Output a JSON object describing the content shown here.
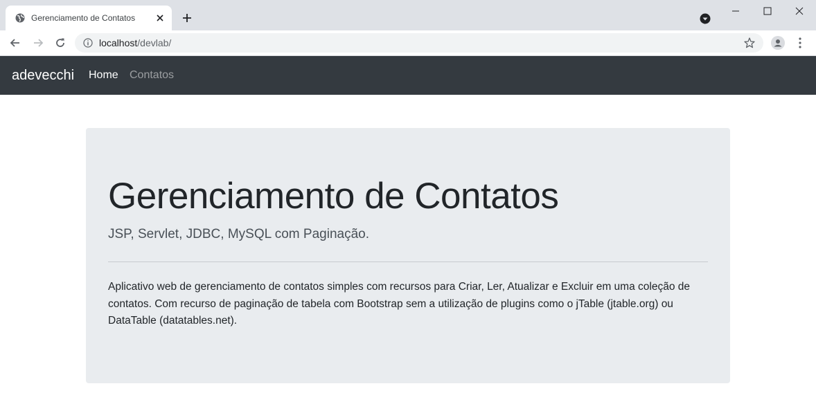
{
  "browser": {
    "tab_title": "Gerenciamento de Contatos",
    "url_host": "localhost",
    "url_path": "/devlab/"
  },
  "navbar": {
    "brand": "adevecchi",
    "links": [
      {
        "label": "Home",
        "active": true
      },
      {
        "label": "Contatos",
        "active": false
      }
    ]
  },
  "jumbotron": {
    "title": "Gerenciamento de Contatos",
    "lead": "JSP, Servlet, JDBC, MySQL com Paginação.",
    "description": "Aplicativo web de gerenciamento de contatos simples com recursos para Criar, Ler, Atualizar e Excluir em uma coleção de contatos. Com recurso de paginação de tabela com Bootstrap sem a utilização de plugins como o jTable (jtable.org) ou DataTable (datatables.net)."
  },
  "colors": {
    "navbar_bg": "#343a40",
    "jumbotron_bg": "#e9ecef",
    "chrome_tabstrip": "#dee1e6"
  }
}
